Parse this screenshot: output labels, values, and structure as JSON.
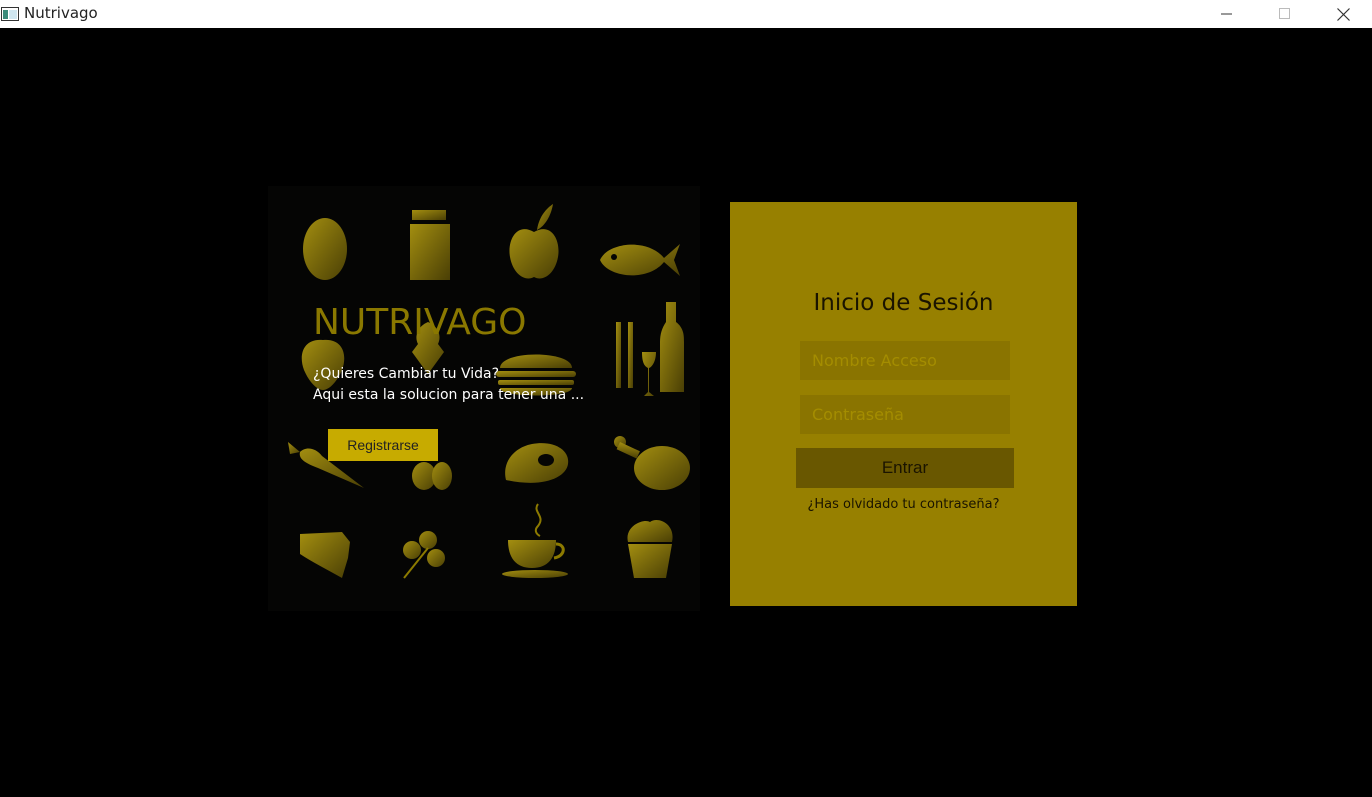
{
  "window": {
    "title": "Nutrivago",
    "icons": [
      "app-icon",
      "minimize-icon",
      "maximize-icon",
      "close-icon"
    ]
  },
  "hero": {
    "brand": "NUTRIVAGO",
    "tagline_line1": "¿Quieres Cambiar tu Vida?",
    "tagline_line2": "Aqui esta la solucion para tener una ...",
    "register_label": "Registrarse",
    "food_icons": [
      "potato-icon",
      "milk-carton-icon",
      "apple-icon",
      "fish-icon",
      "strawberry-icon",
      "ice-cream-icon",
      "burger-icon",
      "cutlery-wine-icon",
      "carrot-icon",
      "mushroom-icon",
      "steak-icon",
      "chicken-leg-icon",
      "cheese-icon",
      "parsley-icon",
      "coffee-cup-icon",
      "muffin-icon"
    ]
  },
  "login": {
    "title": "Inicio de Sesión",
    "username_placeholder": "Nombre Acceso",
    "password_placeholder": "Contraseña",
    "enter_label": "Entrar",
    "forgot_label": "¿Has olvidado tu contraseña?"
  },
  "colors": {
    "background": "#000000",
    "brand_gold": "#8a7800",
    "button_gold": "#c7ab00",
    "login_panel": "#978000",
    "login_field": "#8a7400",
    "login_button": "#695700",
    "icon_gold": "#8c7a00"
  }
}
